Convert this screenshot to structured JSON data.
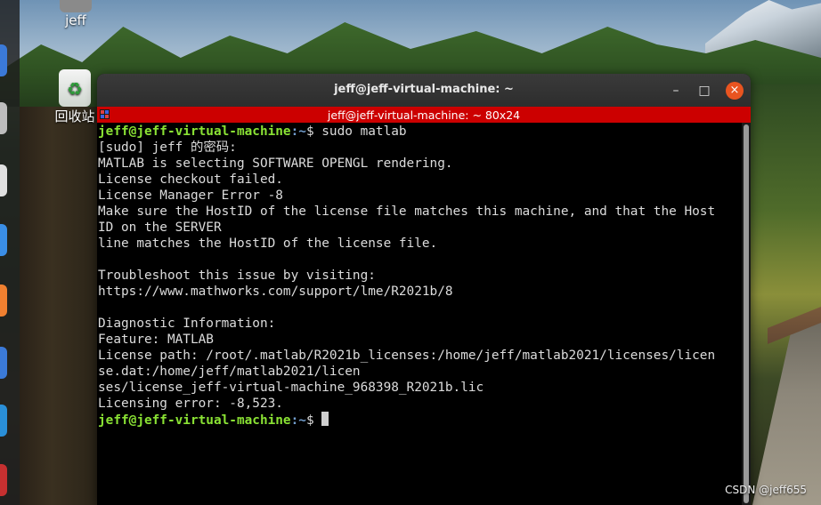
{
  "desktop": {
    "icons": [
      {
        "label": "jeff",
        "icon": "home-folder-icon"
      },
      {
        "label": "回收站",
        "icon": "trash-icon"
      }
    ],
    "watermark": "CSDN @jeff655"
  },
  "dock": {
    "items": [
      "firefox-icon",
      "files-icon",
      "libreoffice-icon",
      "software-icon",
      "help-icon",
      "app-icon",
      "terminal-icon"
    ]
  },
  "window": {
    "title": "jeff@jeff-virtual-machine: ~",
    "minimize": "–",
    "maximize": "□",
    "close": "×",
    "tab_title": "jeff@jeff-virtual-machine: ~ 80x24"
  },
  "terminal": {
    "prompt_user": "jeff@jeff-virtual-machine",
    "prompt_path": ":~",
    "prompt_symbol": "$",
    "command": " sudo matlab",
    "output": [
      "[sudo] jeff 的密码:",
      "MATLAB is selecting SOFTWARE OPENGL rendering.",
      "License checkout failed.",
      "License Manager Error -8",
      "Make sure the HostID of the license file matches this machine, and that the Host",
      "ID on the SERVER",
      "line matches the HostID of the license file.",
      "",
      "Troubleshoot this issue by visiting:",
      "https://www.mathworks.com/support/lme/R2021b/8",
      "",
      "Diagnostic Information:",
      "Feature: MATLAB",
      "License path: /root/.matlab/R2021b_licenses:/home/jeff/matlab2021/licenses/licen",
      "se.dat:/home/jeff/matlab2021/licen",
      "ses/license_jeff-virtual-machine_968398_R2021b.lic",
      "Licensing error: -8,523."
    ]
  }
}
